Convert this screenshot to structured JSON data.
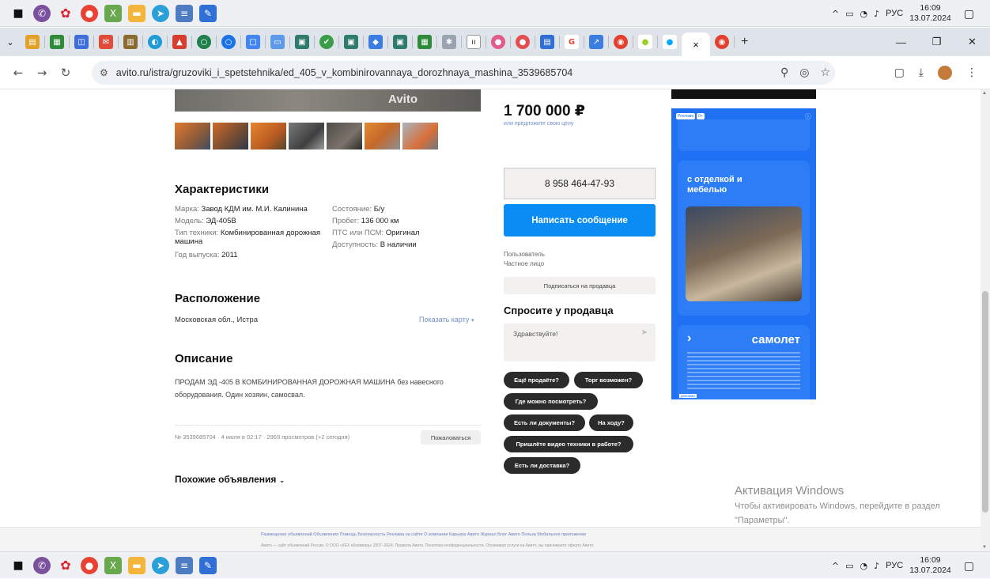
{
  "taskbar": {
    "language": "РУС",
    "time": "16:09",
    "date": "13.07.2024"
  },
  "browser": {
    "url": "avito.ru/istra/gruzoviki_i_spetstehnika/ed_405_v_kombinirovannaya_dorozhnaya_mashina_3539685704",
    "active_tab_close": "×",
    "new_tab": "+"
  },
  "listing": {
    "watermark": "Avito",
    "price": "1 700 000 ₽",
    "price_offer_link": "или предложите свою цену",
    "characteristics_title": "Характеристики",
    "specs_left": [
      {
        "label": "Марка: ",
        "value": "Завод КДМ им. М.И. Калинина"
      },
      {
        "label": "Модель: ",
        "value": "ЭД-405В"
      },
      {
        "label": "Тип техники: ",
        "value": "Комбинированная дорожная машина"
      },
      {
        "label": "Год выпуска: ",
        "value": "2011"
      }
    ],
    "specs_right": [
      {
        "label": "Состояние: ",
        "value": "Б/у"
      },
      {
        "label": "Пробег: ",
        "value": "136 000 км"
      },
      {
        "label": "ПТС или ПСМ: ",
        "value": "Оригинал"
      },
      {
        "label": "Доступность: ",
        "value": "В наличии"
      }
    ],
    "location_title": "Расположение",
    "location": "Московская обл., Истра",
    "show_map": "Показать карту",
    "description_title": "Описание",
    "description": "ПРОДАМ ЭД -405 В КОМБИНИРОВАННАЯ ДОРОЖНАЯ МАШИНА без навесного оборудования. Один хозяин, самосвал.",
    "meta": "№ 3539685704 · 4 июля в 02:17 · 2969 просмотров (+2 сегодня)",
    "complain": "Пожаловаться",
    "similar": "Похожие объявления"
  },
  "seller": {
    "phone": "8 958 464-47-93",
    "write_message": "Написать сообщение",
    "user_label": "Пользователь",
    "user_type": "Частное лицо",
    "subscribe": "Подписаться на продавца",
    "ask_title": "Спросите у продавца",
    "ask_placeholder": "Здравствуйте!",
    "chips": [
      "Ещё продаёте?",
      "Торг возможен?",
      "Где можно посмотреть?",
      "Есть ли документы?",
      "На ходу?",
      "Пришлёте видео техники в работе?",
      "Есть ли доставка?"
    ]
  },
  "ad": {
    "badge": "Реклама",
    "age": "0+",
    "headline": "с отделкой и мебелью",
    "brand": "самолет",
    "arrow": "›",
    "label": "реклама"
  },
  "footer": {
    "links": "Размещение объявлений   Объявления   Помощь   Безопасность   Реклама на сайте   О компании   Карьера   Авито Журнал   Блог   Авито Польза   Мобильное приложение",
    "copyright": "Авито — сайт объявлений России. © ООО «КЕХ еКоммерц» 2007–2024. Правила Авито. Политика конфиденциальности. Оплачивая услуги на Авито, вы принимаете оферту Авито."
  },
  "windows": {
    "activate_title": "Активация Windows",
    "activate_sub": "Чтобы активировать Windows, перейдите в раздел \"Параметры\"."
  }
}
